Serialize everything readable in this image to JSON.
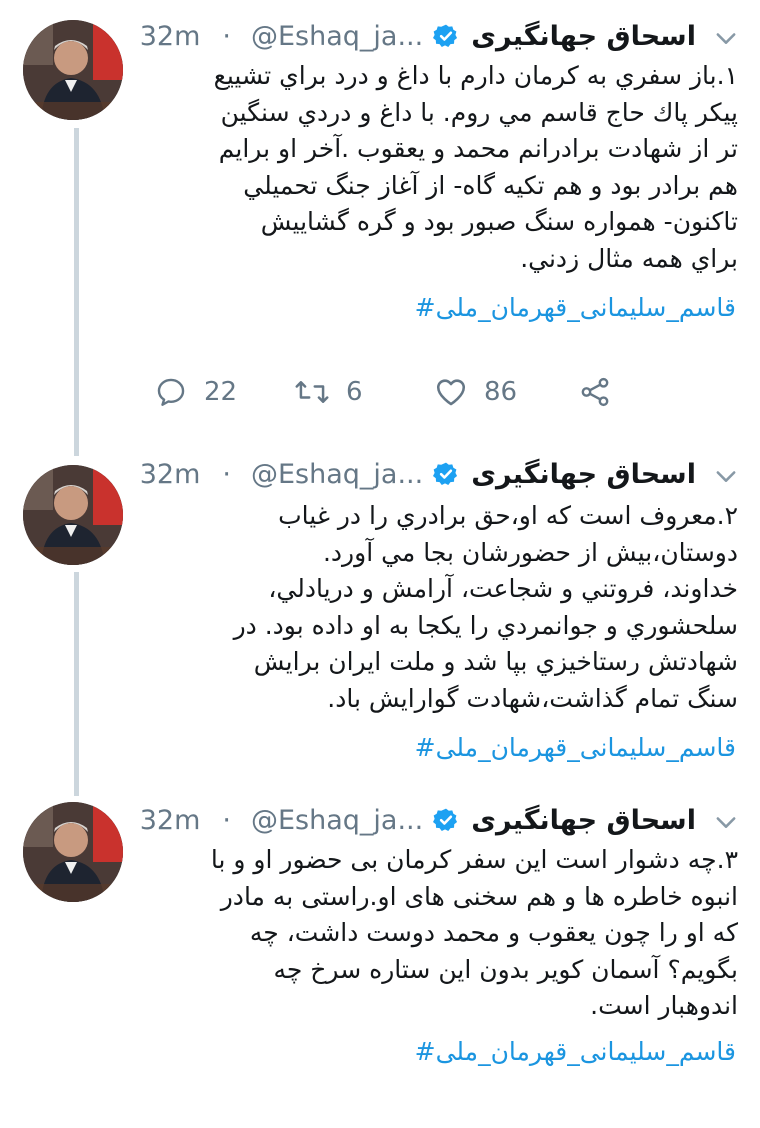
{
  "tweets": [
    {
      "name": "اسحاق جهانگیری",
      "handle": "@Eshaq_ja...",
      "separator": "·",
      "time": "32m",
      "lines": [
        "۱.باز سفري به كرمان دارم با داغ و درد براي تشييع",
        "پيكر پاك حاج قاسم مي روم. با داغ و دردي سنگين",
        "تر از شهادت برادرانم محمد و يعقوب .آخر او برايم",
        "هم برادر بود و هم تكيه گاه- از آغاز جنگ تحميلي",
        "تاكنون- همواره  سنگ صبور بود و  گره گشاييش",
        "براي همه مثال زدني."
      ],
      "hashtag": "#قاسم_سلیمانی_قهرمان_ملی",
      "actions": {
        "reply": "22",
        "retweet": "6",
        "like": "86"
      }
    },
    {
      "name": "اسحاق جهانگیری",
      "handle": "@Eshaq_ja...",
      "separator": "·",
      "time": "32m",
      "lines": [
        "۲.معروف است كه او،حق برادري را در غياب",
        "دوستان،بيش از حضورشان بجا مي آورد.",
        "خداوند، فروتني و شجاعت، آرامش و دريادلي،",
        "سلحشوري و جوانمردي را يكجا به او داده بود. در",
        "شهادتش رستاخيزي بپا شد و ملت ايران برايش",
        "سنگ تمام گذاشت،شهادت گوارايش باد."
      ],
      "hashtag": "#قاسم_سلیمانی_قهرمان_ملی"
    },
    {
      "name": "اسحاق جهانگیری",
      "handle": "@Eshaq_ja...",
      "separator": "·",
      "time": "32m",
      "lines": [
        "۳.چه دشوار است این سفر کرمان بی حضور او و با",
        "انبوه خاطره ها و هم سخنی های او.راستی به مادر",
        "که او را چون یعقوب و محمد دوست داشت، چه",
        "بگویم؟ آسمان کویر بدون این ستاره سرخ چه",
        "اندوهبار است."
      ],
      "hashtag": "#قاسم_سلیمانی_قهرمان_ملی"
    }
  ],
  "colors": {
    "accent": "#1da1f2",
    "link": "#1b95e0",
    "secondary_text": "#657786",
    "thread_line": "#ccd6dd"
  },
  "icons": {
    "verified": "verified-badge-icon",
    "caret": "chevron-down-icon",
    "reply": "reply-icon",
    "retweet": "retweet-icon",
    "like": "heart-icon",
    "share": "share-icon"
  }
}
